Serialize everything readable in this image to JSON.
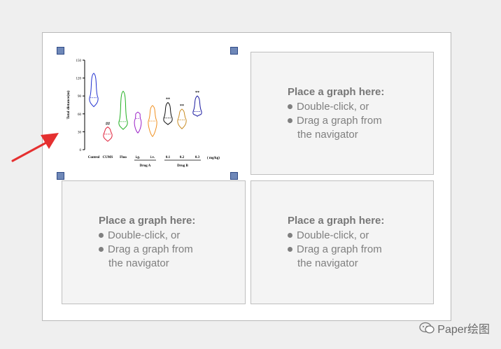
{
  "slots": [
    {
      "title": "Place a graph here:",
      "line1": "Double-click, or",
      "line2a": "Drag a graph from",
      "line2b": "the navigator"
    },
    {
      "title": "Place a graph here:",
      "line1": "Double-click, or",
      "line2a": "Drag a graph from",
      "line2b": "the navigator"
    },
    {
      "title": "Place a graph here:",
      "line1": "Double-click, or",
      "line2a": "Drag a graph from",
      "line2b": "the navigator"
    }
  ],
  "chart_data": {
    "type": "violin",
    "ylabel": "Total distance(m)",
    "ylim": [
      0,
      150
    ],
    "yticks": [
      0,
      30,
      60,
      90,
      120,
      150
    ],
    "categories": [
      "Control",
      "CUMS",
      "Fluo",
      "i.g.",
      "i.v.",
      "0.1",
      "0.2",
      "0.3"
    ],
    "groups": [
      {
        "label": "Drug A",
        "members": [
          "i.g.",
          "i.v."
        ]
      },
      {
        "label": "Drug B",
        "members": [
          "0.1",
          "0.2",
          "0.3"
        ]
      }
    ],
    "unit_label": "( mg/kg)",
    "series": [
      {
        "category": "Control",
        "min": 72,
        "max": 128,
        "median": 87,
        "color": "#1f2fd0",
        "mark": ""
      },
      {
        "category": "CUMS",
        "min": 14,
        "max": 38,
        "median": 26,
        "color": "#e0203a",
        "mark": "##"
      },
      {
        "category": "Fluo",
        "min": 34,
        "max": 98,
        "median": 47,
        "color": "#22b022",
        "mark": ""
      },
      {
        "category": "i.g.",
        "min": 28,
        "max": 63,
        "median": 52,
        "color": "#9b22c8",
        "mark": ""
      },
      {
        "category": "i.v.",
        "min": 22,
        "max": 74,
        "median": 48,
        "color": "#f09020",
        "mark": ""
      },
      {
        "category": "0.1",
        "min": 42,
        "max": 79,
        "median": 53,
        "color": "#111111",
        "mark": "**"
      },
      {
        "category": "0.2",
        "min": 35,
        "max": 68,
        "median": 50,
        "color": "#c88a20",
        "mark": "**"
      },
      {
        "category": "0.3",
        "min": 56,
        "max": 90,
        "median": 64,
        "color": "#1a1aa0",
        "mark": "**"
      }
    ]
  },
  "watermark": {
    "text": "Paper绘图"
  }
}
